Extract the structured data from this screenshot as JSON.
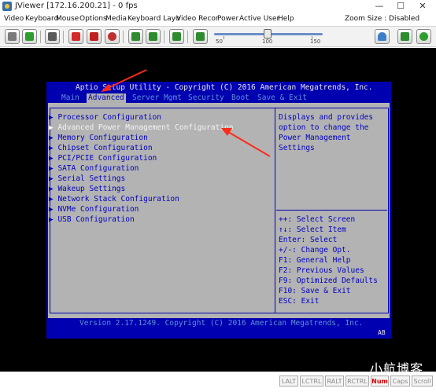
{
  "window": {
    "title": "JViewer [172.16.200.21] - 0 fps",
    "minimize": "—",
    "maximize": "☐",
    "close": "✕"
  },
  "menu": {
    "items": [
      "Video",
      "Keyboard",
      "Mouse",
      "Options",
      "Media",
      "Keyboard Layo",
      "Video Recor",
      "Power",
      "Active User",
      "Help"
    ],
    "zoom_label": "Zoom Size : Disabled"
  },
  "toolbar": {
    "buttons": [
      {
        "icon": "settings-icon",
        "color": "#7a7a7a"
      },
      {
        "icon": "pause-icon",
        "color": "#2f9e2f"
      },
      {
        "icon": "fullscreen-icon",
        "color": "#5a5a5a"
      },
      {
        "icon": "stop-icon",
        "color": "#d42a2a"
      },
      {
        "icon": "floppy-icon",
        "color": "#c02020"
      },
      {
        "icon": "cd-icon",
        "color": "#c03030"
      },
      {
        "icon": "mouse-icon",
        "color": "#2e8b2e"
      },
      {
        "icon": "keyboard-icon",
        "color": "#2e8b2e"
      },
      {
        "icon": "video-icon",
        "color": "#2e8b2e"
      },
      {
        "icon": "hotkeys-icon",
        "color": "#2e8b2e"
      }
    ],
    "slider": {
      "value": 100,
      "labels": [
        "50",
        "100",
        "150"
      ]
    },
    "right_icons": [
      {
        "icon": "user-icon",
        "color": "#3b7fc8"
      },
      {
        "icon": "monitor-icon",
        "color": "#2e8b2e"
      },
      {
        "icon": "power-icon",
        "color": "#2e9e2e"
      }
    ]
  },
  "bios": {
    "title": "Aptio Setup Utility - Copyright (C) 2016 American Megatrends, Inc.",
    "tabs": [
      "Main",
      "Advanced",
      "Server Mgmt",
      "Security",
      "Boot",
      "Save & Exit"
    ],
    "active_tab": "Advanced",
    "items": [
      "▶ Processor Configuration",
      "▶ Advanced Power Management Configuration",
      "▶ Memory Configuration",
      "▶ Chipset Configuration",
      "▶ PCI/PCIE Configuration",
      "▶ SATA Configuration",
      "▶ Serial Settings",
      "▶ Wakeup Settings",
      "▶ Network Stack Configuration",
      "▶ NVMe Configuration",
      "▶ USB Configuration"
    ],
    "selected_index": 1,
    "help_text": [
      "Displays and provides",
      "option to change the",
      "Power Management",
      "Settings"
    ],
    "keys": [
      "++: Select Screen",
      "↑↓: Select Item",
      "Enter: Select",
      "+/-: Change Opt.",
      "F1: General Help",
      "F2: Previous Values",
      "F9: Optimized Defaults",
      "F10: Save & Exit",
      "ESC: Exit"
    ],
    "footer": "Version 2.17.1249. Copyright (C) 2016 American Megatrends, Inc.",
    "corner": "AB",
    "colors": {
      "blue": "#0000b0",
      "gray": "#b3b3b3",
      "text_blue": "#0000c0",
      "highlight": "#f4f4f4"
    }
  },
  "annotations": {
    "arrow_color": "#ff2a1a"
  },
  "status": {
    "keys": [
      {
        "label": "LALT",
        "on": false
      },
      {
        "label": "LCTRL",
        "on": false
      },
      {
        "label": "RALT",
        "on": false
      },
      {
        "label": "RCTRL",
        "on": false
      },
      {
        "label": "Num",
        "on": true
      },
      {
        "label": "Caps",
        "on": false
      },
      {
        "label": "Scroll",
        "on": false
      }
    ],
    "watermark": "小航博客"
  }
}
